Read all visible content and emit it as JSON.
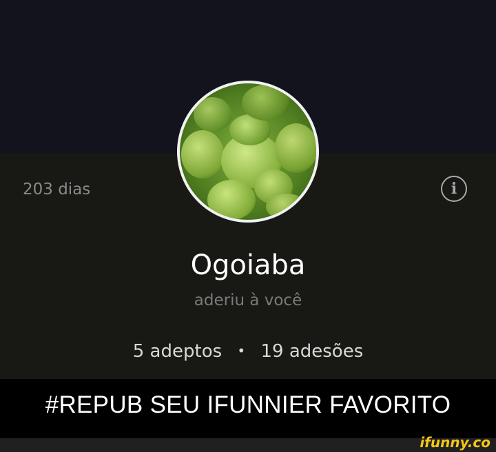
{
  "profile": {
    "days": "203 dias",
    "name": "Ogoiaba",
    "subtitle": "aderiu à você",
    "followers": "5 adeptos",
    "separator": "•",
    "subscriptions": "19 adesões",
    "avatar_icon": "guava-fruit-photo",
    "info_icon": "info-icon"
  },
  "caption": "#REPUB SEU IFUNNIER FAVORITO",
  "watermark": "ifunny.co",
  "colors": {
    "cover_bg": "#12131c",
    "profile_bg": "#181815",
    "caption_bg": "#000000",
    "watermark": "#f5c518"
  }
}
